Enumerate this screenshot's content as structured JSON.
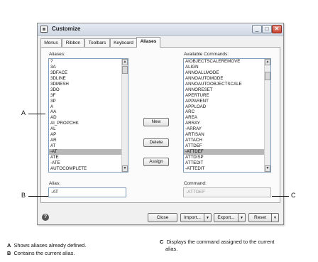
{
  "window": {
    "title": "Customize",
    "min_symbol": "_",
    "max_symbol": "□",
    "close_symbol": "✕"
  },
  "tabs": [
    "Menus",
    "Ribbon",
    "Toolbars",
    "Keyboard",
    "Aliases"
  ],
  "active_tab": "Aliases",
  "aliases": {
    "label": "Aliases:",
    "items": [
      "?",
      "3A",
      "3DFACE",
      "3DLINE",
      "3DMESH",
      "3DO",
      "3F",
      "3P",
      "A",
      "AA",
      "AD",
      "AI_PROPCHK",
      "AL",
      "AP",
      "AR",
      "AT",
      "-AT",
      "ATE",
      "-ATE",
      "AUTOCOMPLETE"
    ],
    "selected": "-AT"
  },
  "commands": {
    "label": "Available Commands:",
    "items": [
      "AIOBJECTSCALEREMOVE",
      "ALIGN",
      "ANNOALLMODE",
      "ANNOAUTOMODE",
      "ANNOAUTOOBJECTSCALE",
      "ANNORESET",
      "APERTURE",
      "APPARENT",
      "APPLOAD",
      "ARC",
      "AREA",
      "ARRAY",
      "-ARRAY",
      "ARTISAN",
      "ATTACH",
      "ATTDEF",
      "-ATTDEF",
      "ATTDISP",
      "ATTEDIT",
      "-ATTEDIT"
    ],
    "selected": "-ATTDEF"
  },
  "buttons": {
    "new": "New",
    "delete": "Delete",
    "assign": "Assign"
  },
  "alias_field": {
    "label": "Alias:",
    "value": "-AT"
  },
  "command_field": {
    "label": "Command:",
    "value": "-ATTDEF"
  },
  "bottom_buttons": {
    "close": "Close",
    "import": "Import...",
    "export": "Export...",
    "reset": "Reset"
  },
  "help_symbol": "?",
  "callouts": {
    "a": "A",
    "b": "B",
    "c": "C"
  },
  "legend": {
    "a_key": "A",
    "a_text": "Shows aliases already defined.",
    "b_key": "B",
    "b_text": "Contains the current alias.",
    "c_key": "C",
    "c_text_1": "Displays the command assigned to the current",
    "c_text_2": "alias."
  }
}
